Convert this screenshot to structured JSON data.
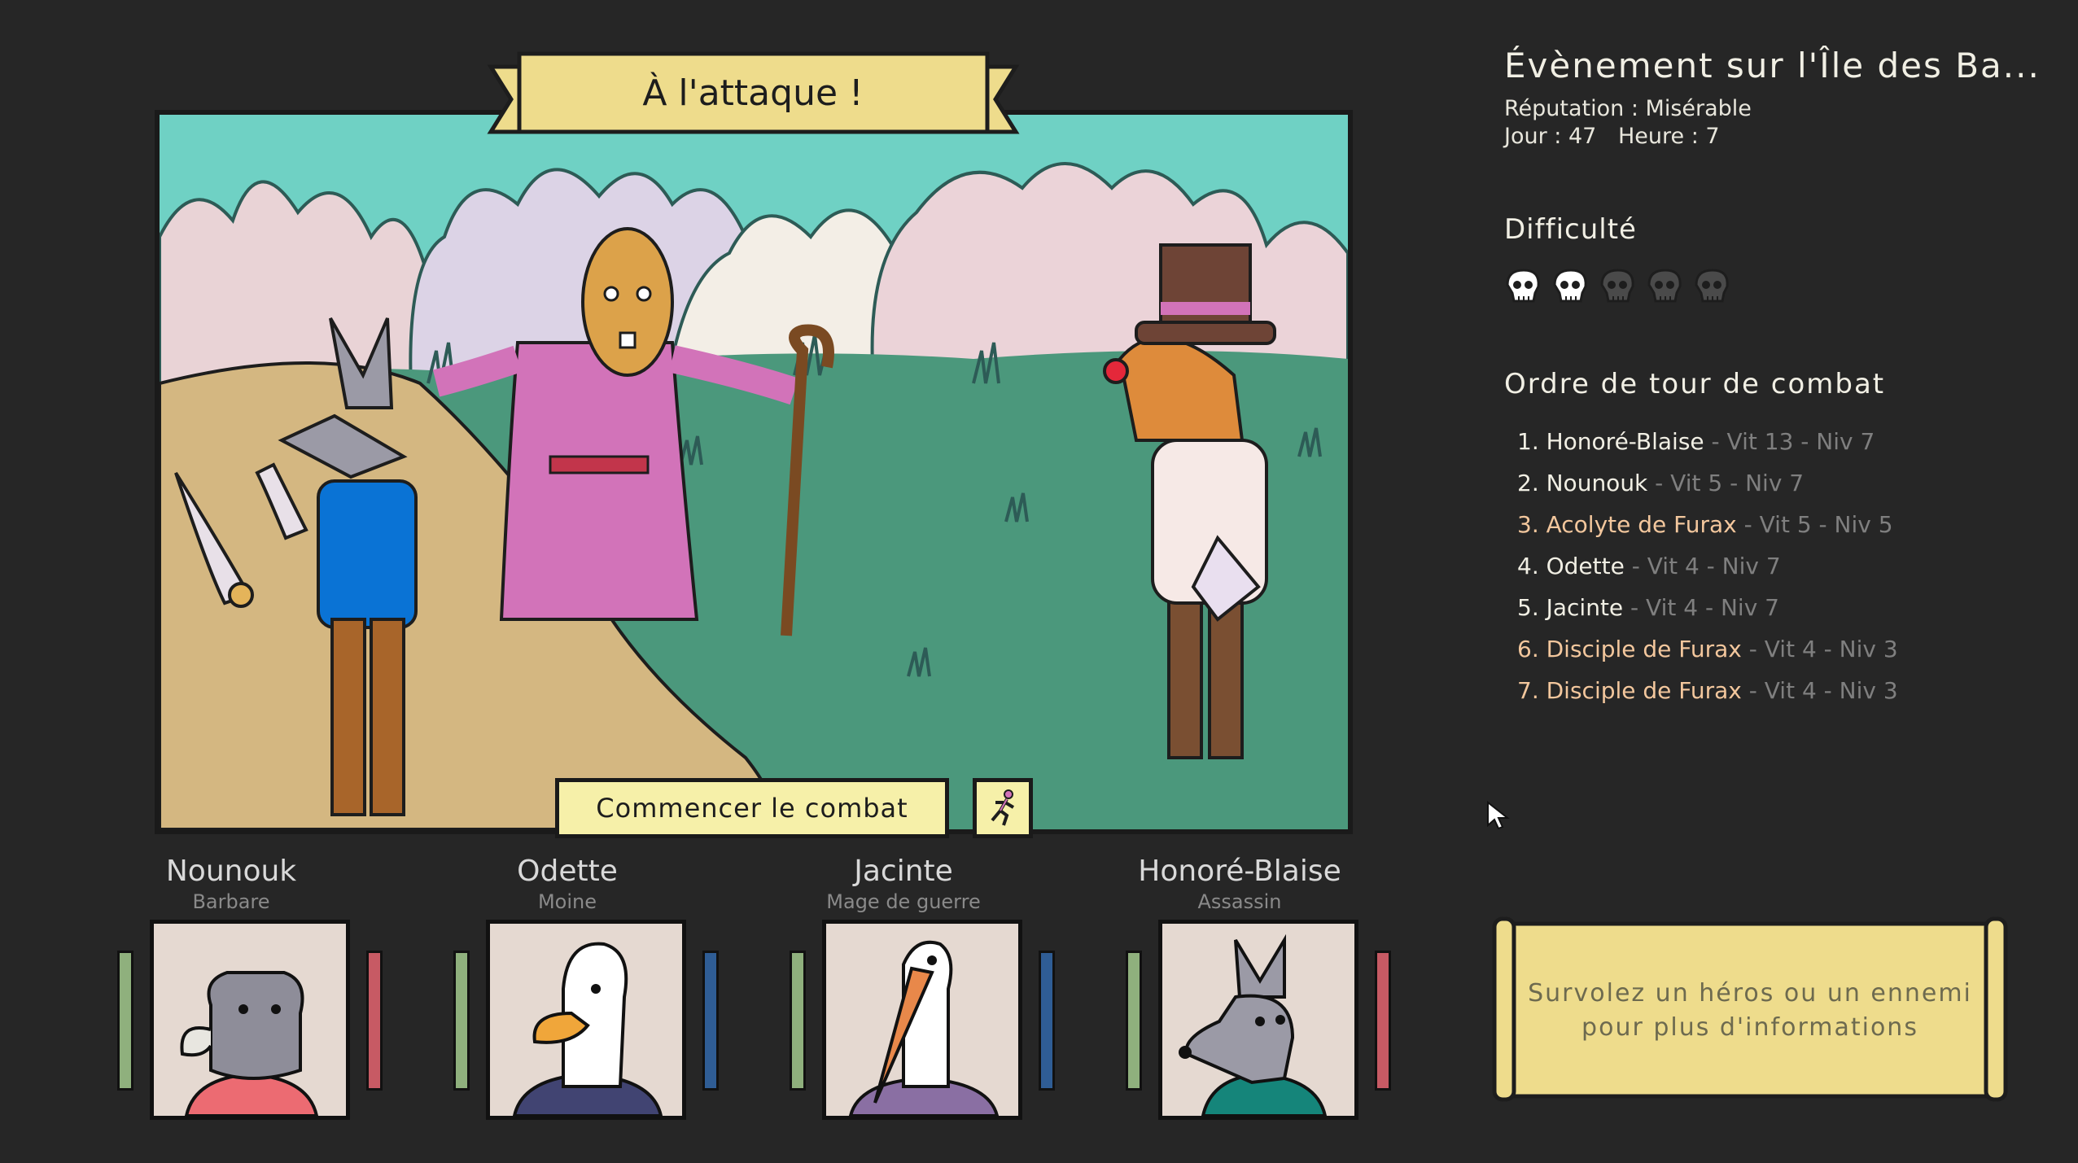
{
  "scene": {
    "title": "À l'attaque !",
    "start_label": "Commencer le combat",
    "flee_icon": "running-figure-icon"
  },
  "heroes": [
    {
      "name": "Nounouk",
      "class": "Barbare",
      "animal": "rhino",
      "shirt_color": "#ec6b72",
      "resource_color": "#c75a64"
    },
    {
      "name": "Odette",
      "class": "Moine",
      "animal": "duck",
      "shirt_color": "#414472",
      "resource_color": "#2f5d95"
    },
    {
      "name": "Jacinte",
      "class": "Mage de guerre",
      "animal": "stork",
      "shirt_color": "#8a6fa3",
      "resource_color": "#2f5d95"
    },
    {
      "name": "Honoré-Blaise",
      "class": "Assassin",
      "animal": "wolf",
      "shirt_color": "#15857a",
      "resource_color": "#c75a64"
    }
  ],
  "event": {
    "title": "Évènement sur l'Île des Ba...",
    "reputation": "Réputation : Misérable",
    "day": "Jour : 47",
    "hour": "Heure : 7"
  },
  "difficulty": {
    "title": "Difficulté",
    "level": 2,
    "max": 5
  },
  "turn_order": {
    "title": "Ordre de tour de combat",
    "entries": [
      {
        "label": "1. Honoré-Blaise",
        "stats": "- Vit 13 - Niv 7",
        "kind": "hero"
      },
      {
        "label": "2. Nounouk",
        "stats": "- Vit 5 - Niv 7",
        "kind": "hero"
      },
      {
        "label": "3. Acolyte de Furax",
        "stats": "- Vit 5 - Niv 5",
        "kind": "enemy"
      },
      {
        "label": "4. Odette",
        "stats": "- Vit 4 - Niv 7",
        "kind": "hero"
      },
      {
        "label": "5. Jacinte",
        "stats": "- Vit 4 - Niv 7",
        "kind": "hero"
      },
      {
        "label": "6. Disciple de Furax",
        "stats": "- Vit 4 - Niv 3",
        "kind": "enemy"
      },
      {
        "label": "7. Disciple de Furax",
        "stats": "- Vit 4 - Niv 3",
        "kind": "enemy"
      }
    ]
  },
  "hint": {
    "line1": "Survolez un héros ou un ennemi",
    "line2": "pour plus d'informations"
  },
  "colors": {
    "background": "#262626",
    "hero_text": "#f1efe4",
    "enemy_text": "#f3c79d",
    "stat_text": "#7f7f7f",
    "button_fill": "#f6f0a9",
    "scroll_fill": "#eedc8c"
  }
}
